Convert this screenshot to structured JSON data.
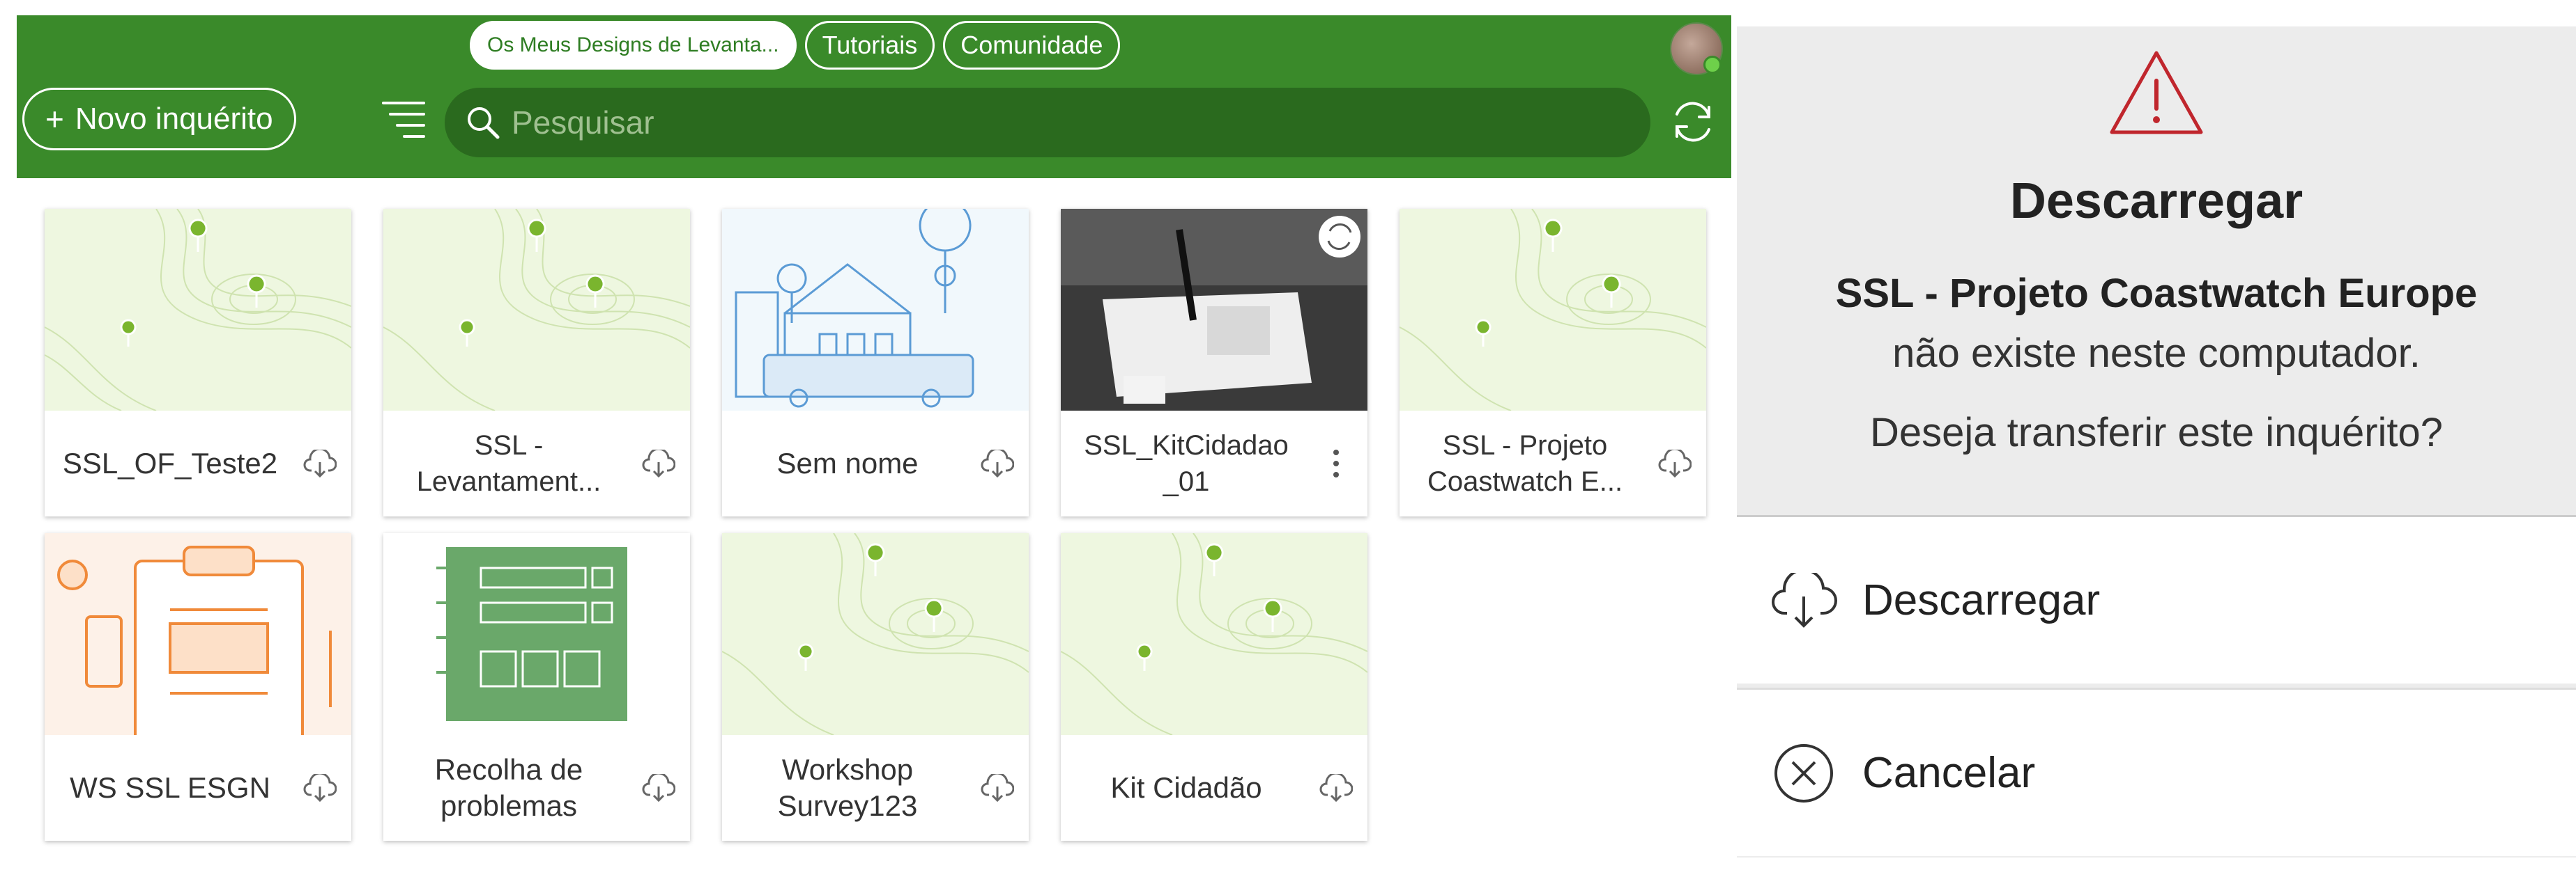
{
  "header": {
    "tabs": [
      {
        "label": "Os Meus Designs de Levanta...",
        "active": true
      },
      {
        "label": "Tutoriais",
        "active": false
      },
      {
        "label": "Comunidade",
        "active": false
      }
    ],
    "new_survey_label": "Novo inquérito",
    "search_placeholder": "Pesquisar"
  },
  "surveys": [
    {
      "title": "SSL_OF_Teste2",
      "thumb": "map",
      "action": "cloud-download-icon"
    },
    {
      "title": "SSL - Levantament...",
      "thumb": "map",
      "action": "cloud-download-icon"
    },
    {
      "title": "Sem nome",
      "thumb": "city",
      "action": "cloud-download-icon"
    },
    {
      "title": "SSL_KitCidadao _01",
      "thumb": "photo",
      "action": "more-vertical-icon"
    },
    {
      "title": "SSL - Projeto Coastwatch E...",
      "thumb": "map",
      "action": "cloud-download-icon"
    },
    {
      "title": "WS SSL ESGN",
      "thumb": "clipboard",
      "action": "cloud-download-icon"
    },
    {
      "title": "Recolha de problemas",
      "thumb": "form",
      "action": "cloud-download-icon"
    },
    {
      "title": "Workshop Survey123",
      "thumb": "map",
      "action": "cloud-download-icon"
    },
    {
      "title": "Kit Cidadão",
      "thumb": "map",
      "action": "cloud-download-icon"
    }
  ],
  "dialog": {
    "title": "Descarregar",
    "survey_name": "SSL - Projeto Coastwatch Europe",
    "message": "não existe neste computador.",
    "question": "Deseja transferir este inquérito?",
    "download_label": "Descarregar",
    "cancel_label": "Cancelar"
  },
  "colors": {
    "topbar": "#3a8a2a",
    "search": "#2a6a1e",
    "warning": "#c0262d"
  }
}
